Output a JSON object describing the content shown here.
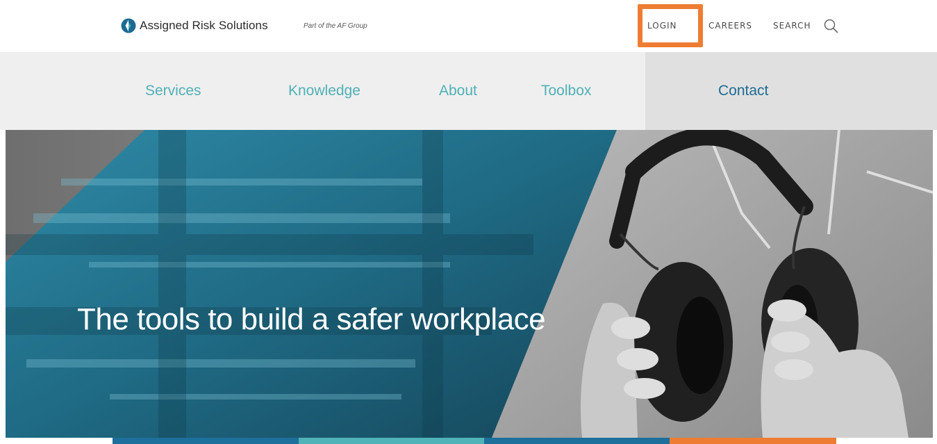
{
  "header": {
    "logo_text": "Assigned Risk Solutions",
    "tagline": "Part of the AF Group",
    "utility_links": {
      "login": "LOGIN",
      "careers": "CAREERS",
      "search": "SEARCH"
    },
    "highlight_color": "#ee7d33"
  },
  "nav": {
    "items": [
      {
        "label": "Services"
      },
      {
        "label": "Knowledge"
      },
      {
        "label": "About"
      },
      {
        "label": "Toolbox"
      },
      {
        "label": "Contact"
      }
    ],
    "link_color": "#4fb0b6",
    "active_color": "#1c6b94"
  },
  "hero": {
    "heading": "The tools to build a safer workplace",
    "image_description_icon": "hearing-protection-earmuffs"
  },
  "bands": {
    "colors": [
      "#1d6f9c",
      "#4fb3b8",
      "#1d6f9c",
      "#ee7d33"
    ]
  }
}
